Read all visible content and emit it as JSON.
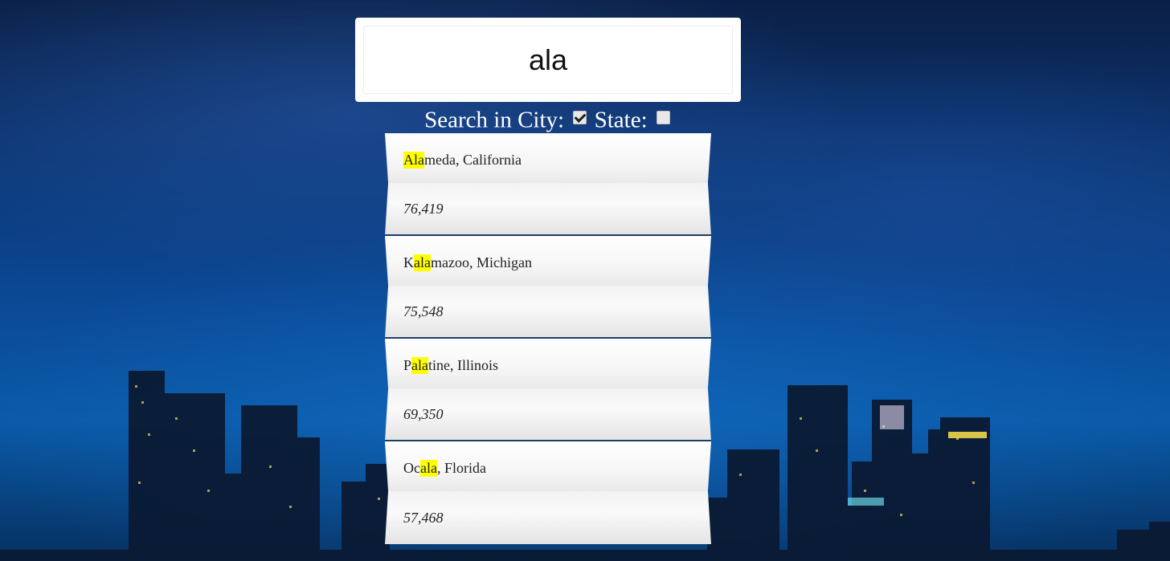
{
  "search": {
    "value": "ala"
  },
  "options": {
    "city_label": "Search in City:",
    "city_checked": true,
    "state_label": "State:",
    "state_checked": false
  },
  "results": [
    {
      "pre": "",
      "match": "Ala",
      "post": "meda, California",
      "population": "76,419"
    },
    {
      "pre": "K",
      "match": "ala",
      "post": "mazoo, Michigan",
      "population": "75,548"
    },
    {
      "pre": "P",
      "match": "ala",
      "post": "tine, Illinois",
      "population": "69,350"
    },
    {
      "pre": "Oc",
      "match": "ala",
      "post": ", Florida",
      "population": "57,468"
    }
  ],
  "colors": {
    "highlight": "#ffff00",
    "background": "#0b4a97"
  }
}
